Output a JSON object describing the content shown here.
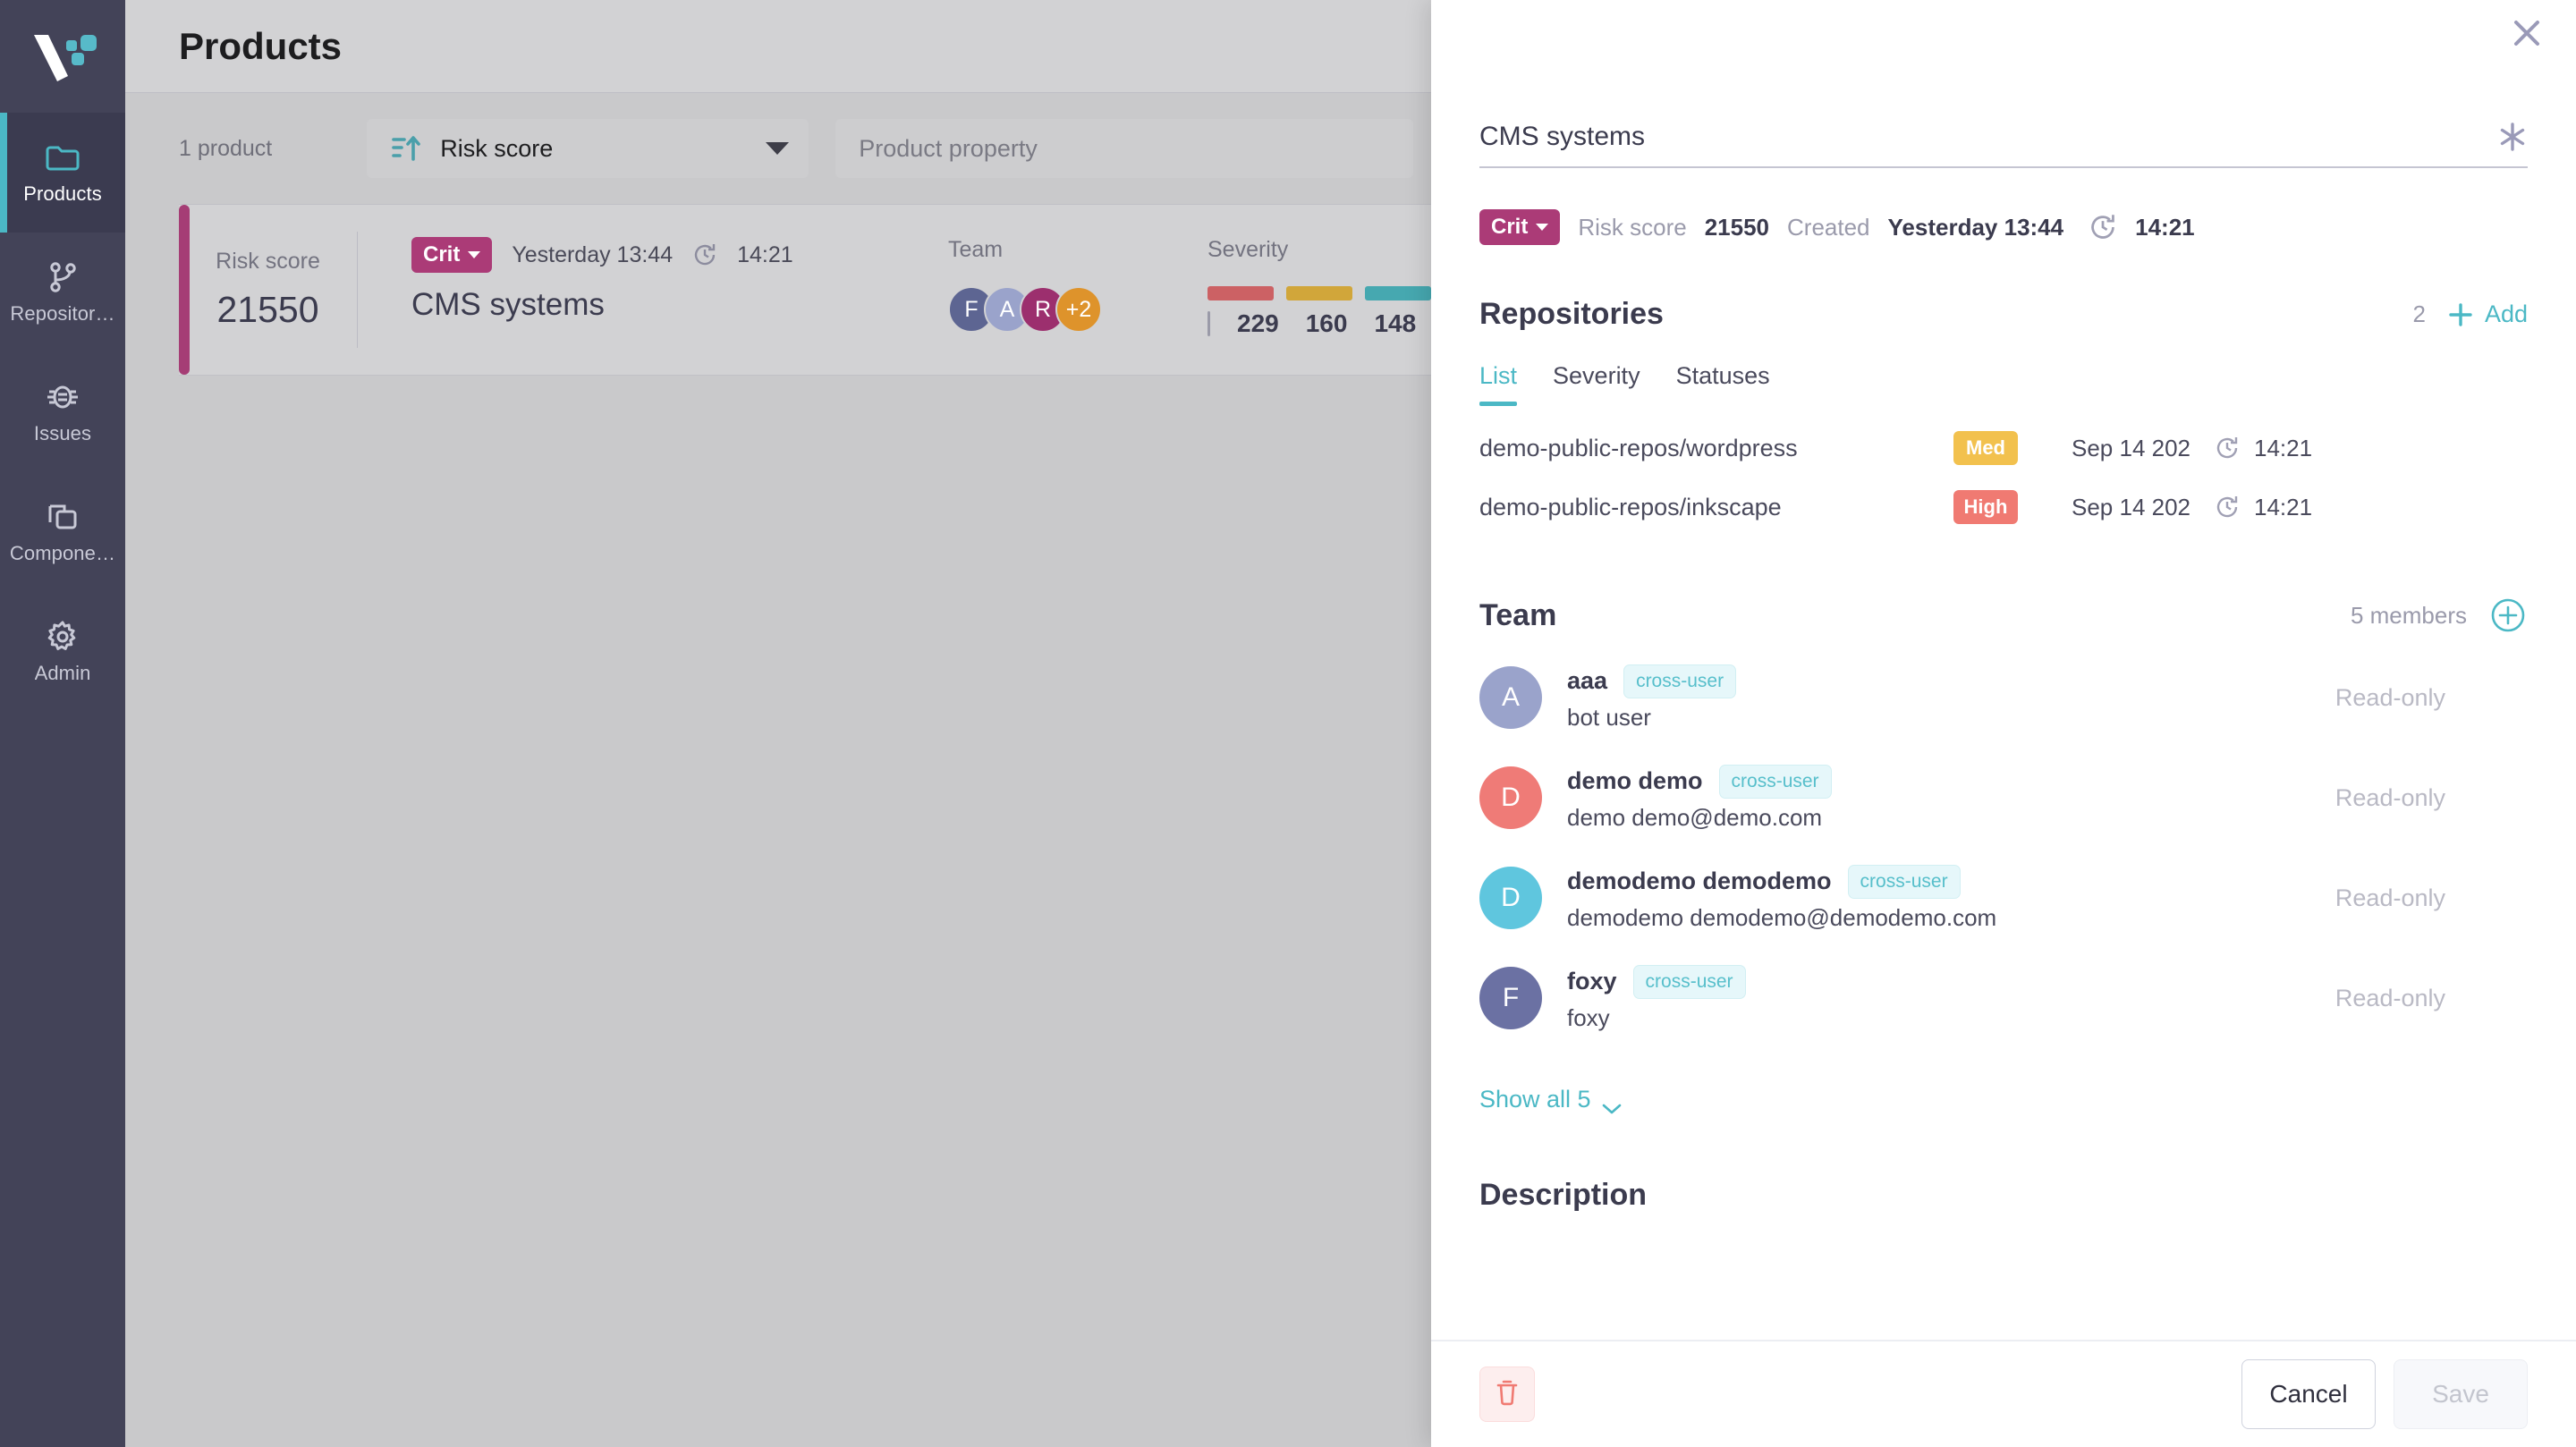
{
  "sidebar": {
    "logo_name": "vulcan-logo",
    "items": [
      {
        "label": "Products",
        "icon": "folder-icon",
        "active": true
      },
      {
        "label": "Repositor…",
        "icon": "repository-icon",
        "active": false
      },
      {
        "label": "Issues",
        "icon": "bug-icon",
        "active": false
      },
      {
        "label": "Compone…",
        "icon": "components-icon",
        "active": false
      },
      {
        "label": "Admin",
        "icon": "gear-icon",
        "active": false
      }
    ]
  },
  "header": {
    "title": "Products"
  },
  "toolbar": {
    "count_text": "1 product",
    "sort_label": "Risk score",
    "sort_icon": "sort-ascending-icon",
    "property_placeholder": "Product property"
  },
  "product_card": {
    "risk_score_label": "Risk score",
    "risk_score_value": "21550",
    "severity_pill": "Crit",
    "created_date": "Yesterday 13:44",
    "updated_time": "14:21",
    "name": "CMS systems",
    "team_label": "Team",
    "severity_label": "Severity",
    "avatars": [
      {
        "initial": "F",
        "color": "#5d6592"
      },
      {
        "initial": "A",
        "color": "#9aa3cb"
      },
      {
        "initial": "R",
        "color": "#9c2f6e"
      },
      {
        "initial": "+2",
        "color": "#de932b"
      }
    ],
    "severity_bars": [
      {
        "value": "229",
        "color": "#cc6164"
      },
      {
        "value": "160",
        "color": "#d1a63a"
      },
      {
        "value": "148",
        "color": "#46a8b0"
      }
    ]
  },
  "panel": {
    "close_icon": "close-icon",
    "star_icon": "asterisk-icon",
    "title_value": "CMS systems",
    "meta": {
      "severity_pill": "Crit",
      "risk_score_label": "Risk score",
      "risk_score_value": "21550",
      "created_label": "Created",
      "created_value": "Yesterday 13:44",
      "updated_time": "14:21"
    },
    "repositories": {
      "title": "Repositories",
      "count": "2",
      "add_label": "Add",
      "tabs": [
        {
          "label": "List",
          "active": true
        },
        {
          "label": "Severity",
          "active": false
        },
        {
          "label": "Statuses",
          "active": false
        }
      ],
      "rows": [
        {
          "name": "demo-public-repos/wordpress",
          "badge": "Med",
          "badge_color": "#f2c14e",
          "date": "Sep 14 202",
          "time": "14:21"
        },
        {
          "name": "demo-public-repos/inkscape",
          "badge": "High",
          "badge_color": "#f07a72",
          "date": "Sep 14 202",
          "time": "14:21"
        }
      ]
    },
    "team": {
      "title": "Team",
      "members_count": "5 members",
      "add_icon": "circle-plus-icon",
      "members": [
        {
          "initial": "A",
          "color": "#9aa3cb",
          "name": "aaa",
          "chip": "cross-user",
          "sub": "bot user",
          "role": "Read-only"
        },
        {
          "initial": "D",
          "color": "#ef7b77",
          "name": "demo demo",
          "chip": "cross-user",
          "sub": "demo demo@demo.com",
          "role": "Read-only"
        },
        {
          "initial": "D",
          "color": "#5fc6de",
          "name": "demodemo demodemo",
          "chip": "cross-user",
          "sub": "demodemo demodemo@demodemo.com",
          "role": "Read-only"
        },
        {
          "initial": "F",
          "color": "#6b71a3",
          "name": "foxy",
          "chip": "cross-user",
          "sub": "foxy",
          "role": "Read-only"
        }
      ],
      "show_all_label": "Show all 5"
    },
    "description": {
      "title": "Description"
    },
    "footer": {
      "delete_icon": "trash-icon",
      "cancel_label": "Cancel",
      "save_label": "Save"
    }
  },
  "colors": {
    "accent": "#4bb8c5",
    "sidebar_bg": "#434358",
    "critical": "#ab3b77",
    "high": "#f07a72",
    "medium": "#f2c14e"
  }
}
